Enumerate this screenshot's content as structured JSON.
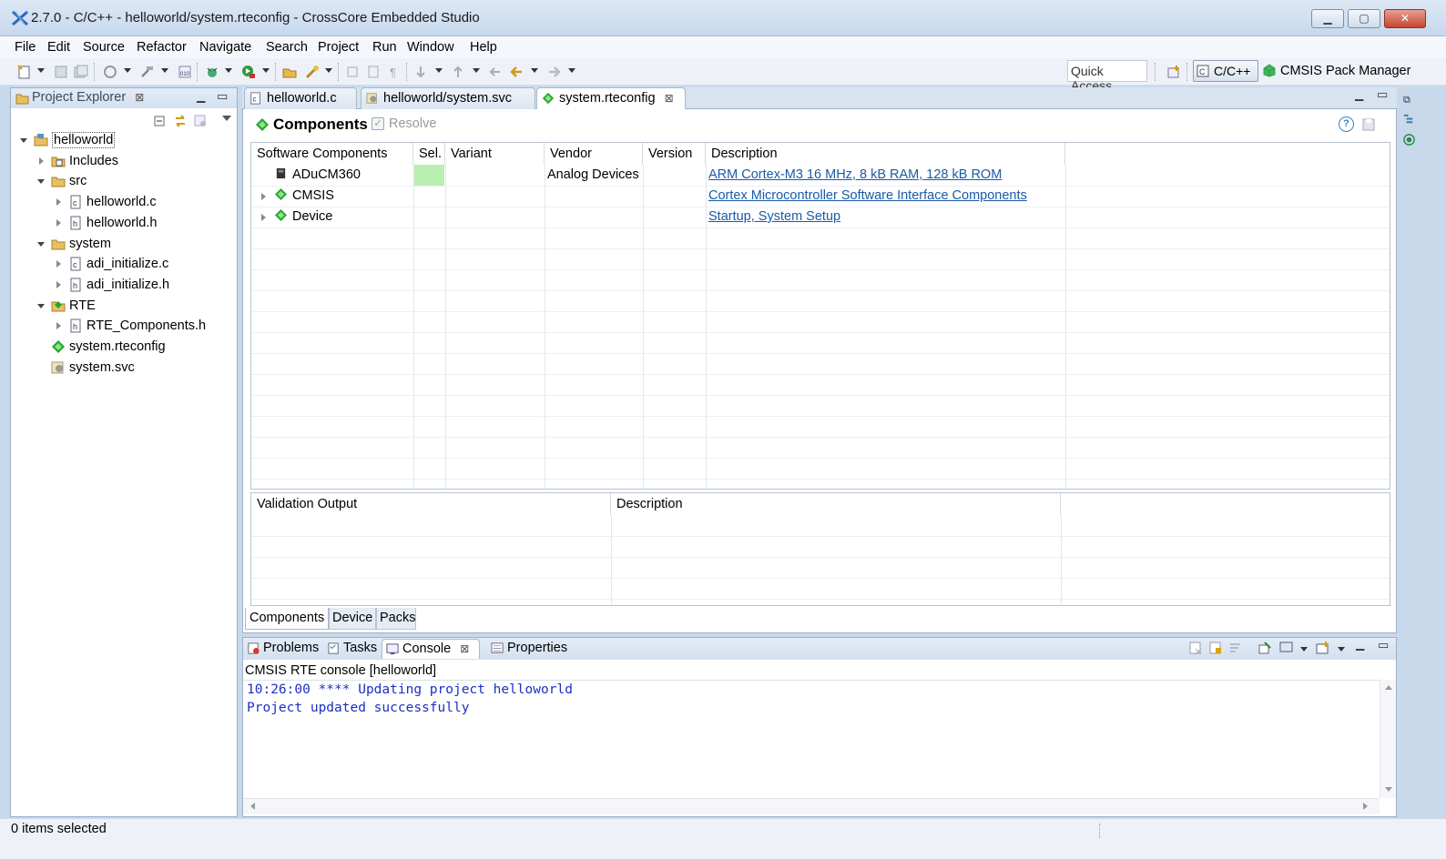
{
  "window": {
    "title": "2.7.0 - C/C++ - helloworld/system.rteconfig - CrossCore Embedded Studio"
  },
  "menu": [
    "File",
    "Edit",
    "Source",
    "Refactor",
    "Navigate",
    "Search",
    "Project",
    "Run",
    "Window",
    "Help"
  ],
  "toolbar": {
    "quick_access": "Quick Access",
    "perspective_active": "C/C++",
    "perspective_other": "CMSIS Pack Manager"
  },
  "project_explorer": {
    "title": "Project Explorer",
    "tree": [
      {
        "label": "helloworld",
        "icon": "project-icon",
        "expanded": true
      },
      {
        "label": "Includes",
        "icon": "includes-icon",
        "expanded": false
      },
      {
        "label": "src",
        "icon": "folder-icon",
        "expanded": true
      },
      {
        "label": "helloworld.c",
        "icon": "c-file-icon",
        "expanded": false
      },
      {
        "label": "helloworld.h",
        "icon": "h-file-icon",
        "expanded": false
      },
      {
        "label": "system",
        "icon": "folder-icon",
        "expanded": true
      },
      {
        "label": "adi_initialize.c",
        "icon": "c-file-icon",
        "expanded": false
      },
      {
        "label": "adi_initialize.h",
        "icon": "h-file-icon",
        "expanded": false
      },
      {
        "label": "RTE",
        "icon": "rte-folder-icon",
        "expanded": true
      },
      {
        "label": "RTE_Components.h",
        "icon": "h-file-icon",
        "expanded": false
      },
      {
        "label": "system.rteconfig",
        "icon": "rteconfig-icon"
      },
      {
        "label": "system.svc",
        "icon": "svc-icon"
      }
    ]
  },
  "editor_tabs": [
    {
      "label": "helloworld.c",
      "icon": "c-file-icon"
    },
    {
      "label": "helloworld/system.svc",
      "icon": "svc-icon"
    },
    {
      "label": "system.rteconfig",
      "icon": "rteconfig-icon",
      "active": true
    }
  ],
  "components_editor": {
    "heading": "Components",
    "resolve": "Resolve",
    "columns": [
      "Software Components",
      "Sel.",
      "Variant",
      "Vendor",
      "Version",
      "Description"
    ],
    "rows": [
      {
        "name": "ADuCM360",
        "icon": "chip-icon",
        "sel": "",
        "variant": "",
        "vendor": "Analog Devices",
        "version": "",
        "description": "ARM Cortex-M3 16 MHz, 8 kB RAM, 128 kB ROM"
      },
      {
        "name": "CMSIS",
        "icon": "component-icon",
        "sel": "",
        "variant": "",
        "vendor": "",
        "version": "",
        "description": "Cortex Microcontroller Software Interface Components"
      },
      {
        "name": "Device",
        "icon": "component-icon",
        "sel": "",
        "variant": "",
        "vendor": "",
        "version": "",
        "description": "Startup, System Setup"
      }
    ],
    "validation_columns": [
      "Validation Output",
      "Description"
    ],
    "bottom_tabs": [
      "Components",
      "Device",
      "Packs"
    ]
  },
  "bottom_panel": {
    "tabs": [
      "Problems",
      "Tasks",
      "Console",
      "Properties"
    ],
    "console_title": "CMSIS RTE console [helloworld]",
    "console_lines": [
      "10:26:00 **** Updating project helloworld",
      "Project updated successfully"
    ]
  },
  "status": {
    "text": "0 items selected"
  },
  "colors": {
    "link": "#1a5aa8",
    "console_text": "#1c2fc4",
    "sel_cell": "#b9f0b1",
    "component_green": "#19a31e"
  }
}
